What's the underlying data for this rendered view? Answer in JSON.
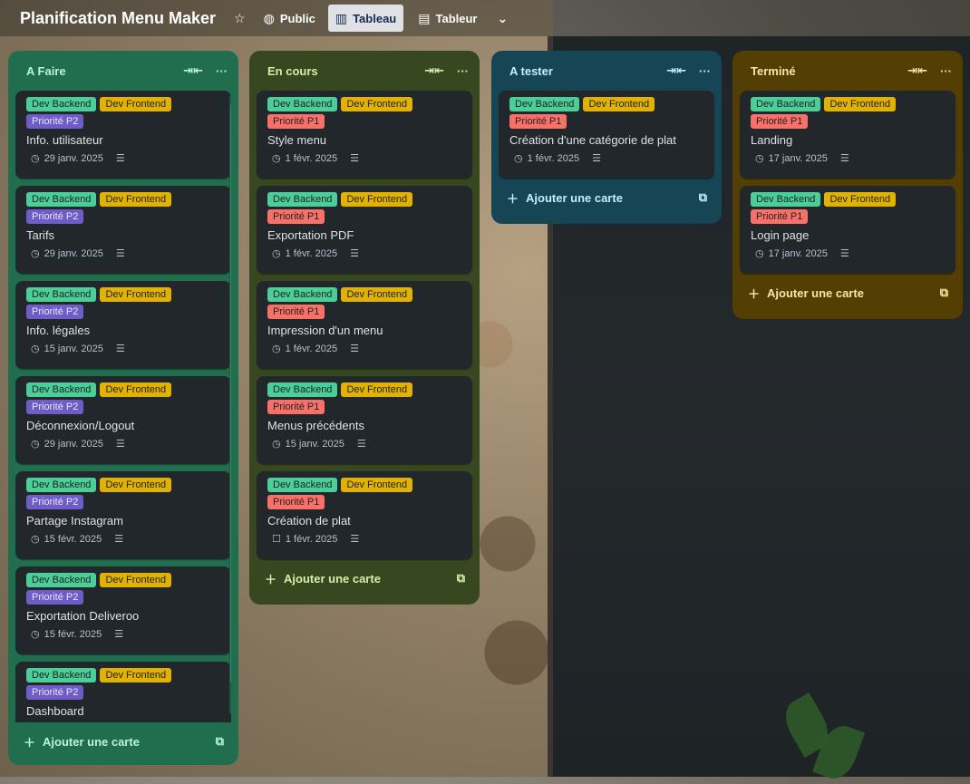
{
  "board": {
    "title": "Planification Menu Maker"
  },
  "topbar": {
    "visibility": "Public",
    "view_active": "Tableau",
    "view_table": "Tableur"
  },
  "common": {
    "label_backend": "Dev Backend",
    "label_frontend": "Dev Frontend",
    "add_card": "Ajouter une carte"
  },
  "colors": {
    "green_list": "#216e4e",
    "olive_list": "#37471f",
    "teal_list": "#164555",
    "amber_list": "#533f04"
  },
  "lists": [
    {
      "title": "A Faire",
      "cards": [
        {
          "priority": "Priorité P2",
          "title": "Info. utilisateur",
          "date": "29 janv. 2025"
        },
        {
          "priority": "Priorité P2",
          "title": "Tarifs",
          "date": "29 janv. 2025"
        },
        {
          "priority": "Priorité P2",
          "title": "Info. légales",
          "date": "15 janv. 2025"
        },
        {
          "priority": "Priorité P2",
          "title": "Déconnexion/Logout",
          "date": "29 janv. 2025"
        },
        {
          "priority": "Priorité P2",
          "title": "Partage Instagram",
          "date": "15 févr. 2025"
        },
        {
          "priority": "Priorité P2",
          "title": "Exportation Deliveroo",
          "date": "15 févr. 2025"
        },
        {
          "priority": "Priorité P2",
          "title": "Dashboard",
          "date": ""
        }
      ]
    },
    {
      "title": "En cours",
      "cards": [
        {
          "priority": "Priorité P1",
          "title": "Style menu",
          "date": "1 févr. 2025"
        },
        {
          "priority": "Priorité P1",
          "title": "Exportation PDF",
          "date": "1 févr. 2025"
        },
        {
          "priority": "Priorité P1",
          "title": "Impression d'un menu",
          "date": "1 févr. 2025"
        },
        {
          "priority": "Priorité P1",
          "title": "Menus précédents",
          "date": "15 janv. 2025"
        },
        {
          "priority": "Priorité P1",
          "title": "Création de plat",
          "date": "1 févr. 2025"
        }
      ]
    },
    {
      "title": "A tester",
      "cards": [
        {
          "priority": "Priorité P1",
          "title": "Création d'une catégorie de plat",
          "date": "1 févr. 2025"
        }
      ]
    },
    {
      "title": "Terminé",
      "cards": [
        {
          "priority": "Priorité P1",
          "title": "Landing",
          "date": "17 janv. 2025"
        },
        {
          "priority": "Priorité P1",
          "title": "Login page",
          "date": "17 janv. 2025"
        }
      ]
    }
  ]
}
